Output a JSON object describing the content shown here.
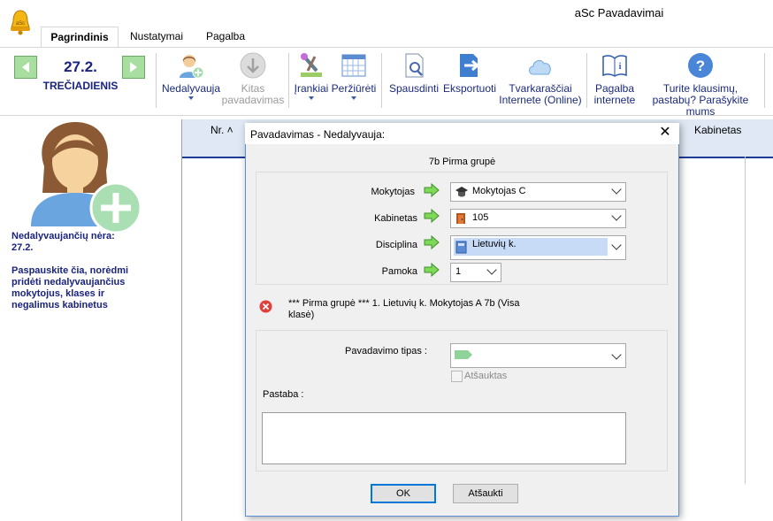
{
  "app": {
    "title": "aSc Pavadavimai",
    "icon": "bell-icon"
  },
  "tabs": [
    {
      "label": "Pagrindinis",
      "active": true
    },
    {
      "label": "Nustatymai"
    },
    {
      "label": "Pagalba"
    }
  ],
  "date_nav": {
    "date": "27.2.",
    "day": "TREČIADIENIS"
  },
  "ribbon": {
    "absent": "Nedalyvauja",
    "other_sub_1": "Kitas",
    "other_sub_2": "pavadavimas",
    "tools": "Įrankiai",
    "views": "Peržiūrėti",
    "print": "Spausdinti",
    "export": "Eksportuoti",
    "online_1": "Tvarkaraščiai",
    "online_2": "Internete (Online)",
    "help_1": "Pagalba",
    "help_2": "internete",
    "question_1": "Turite klausimų,",
    "question_2": "pastabų? Parašykite mums"
  },
  "left_panel": {
    "absent_none": "Nedalyvaujančių nėra:",
    "absent_date": "27.2.",
    "hint_lines": [
      "Paspauskite čia, norėdmi",
      "pridėti nedalyvaujančius",
      "mokytojus, klases ir",
      "negalimus kabinetus"
    ]
  },
  "grid": {
    "col_nr": "Nr. ˄",
    "col_room": "Kabinetas"
  },
  "dialog": {
    "title": "Pavadavimas - Nedalyvauja:",
    "group": "7b Pirma grupė",
    "fields": {
      "teacher_label": "Mokytojas",
      "teacher_value": "Mokytojas C",
      "room_label": "Kabinetas",
      "room_value": "105",
      "subject_label": "Disciplina",
      "subject_value": "Lietuvių k.",
      "lesson_label": "Pamoka",
      "lesson_value": "1"
    },
    "warning_line1": "*** Pirma grupė *** 1. Lietuvių k. Mokytojas A 7b (Visa",
    "warning_line2": "klasė)",
    "sub_type_label": "Pavadavimo tipas :",
    "cancelled_label": "Atšauktas",
    "note_label": "Pastaba :",
    "ok": "OK",
    "cancel": "Atšaukti"
  },
  "colors": {
    "accent": "#1a237e",
    "green": "#a8dfa0",
    "highlight": "#c7daf6"
  }
}
